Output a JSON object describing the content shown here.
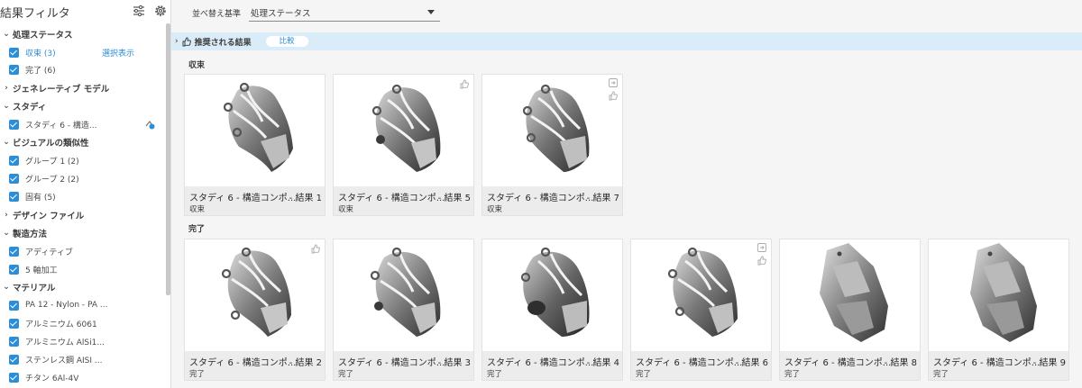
{
  "sidebar": {
    "title": "結果フィルタ",
    "sections": {
      "status": "処理ステータス",
      "generative_model": "ジェネレーティブ モデル",
      "study": "スタディ",
      "visual_similarity": "ビジュアルの類似性",
      "design_file": "デザイン ファイル",
      "manufacturing": "製造方法",
      "material": "マテリアル"
    },
    "status_items": [
      "収束 (3)",
      "完了 (6)"
    ],
    "select_display": "選択表示",
    "study_items": [
      "スタディ 6 - 構造..."
    ],
    "visual_items": [
      "グループ 1 (2)",
      "グループ 2 (2)",
      "固有 (5)"
    ],
    "manufacturing_items": [
      "アディティブ",
      "5 軸加工"
    ],
    "material_items": [
      "PA 12 - Nylon - PA ...",
      "アルミニウム 6061",
      "アルミニウム AlSi1...",
      "ステンレス鋼 AISI ...",
      "チタン 6Al-4V"
    ]
  },
  "toolbar": {
    "sort_label": "並べ替え基準",
    "sort_value": "処理ステータス"
  },
  "recommended": {
    "label": "推奨される結果",
    "compare": "比較"
  },
  "groups": {
    "converged": "収束",
    "completed": "完了"
  },
  "cards_converged": [
    {
      "name": "スタディ 6 - 構造コンポ...",
      "result": "- 結果 1",
      "status": "収束"
    },
    {
      "name": "スタディ 6 - 構造コンポ...",
      "result": "- 結果 5",
      "status": "収束"
    },
    {
      "name": "スタディ 6 - 構造コンポ...",
      "result": "- 結果 7",
      "status": "収束"
    }
  ],
  "cards_completed": [
    {
      "name": "スタディ 6 - 構造コンポ...",
      "result": "- 結果 2",
      "status": "完了"
    },
    {
      "name": "スタディ 6 - 構造コンポ...",
      "result": "- 結果 3",
      "status": "完了"
    },
    {
      "name": "スタディ 6 - 構造コンポ...",
      "result": "- 結果 4",
      "status": "完了"
    },
    {
      "name": "スタディ 6 - 構造コンポ...",
      "result": "- 結果 6",
      "status": "完了"
    },
    {
      "name": "スタディ 6 - 構造コンポ...",
      "result": "- 結果 8",
      "status": "完了"
    },
    {
      "name": "スタディ 6 - 構造コンポ...",
      "result": "- 結果 9",
      "status": "完了"
    }
  ],
  "colors": {
    "accent": "#2b8ed6",
    "recommended_bar": "#d9ecf8",
    "card_footer": "#ececec"
  }
}
